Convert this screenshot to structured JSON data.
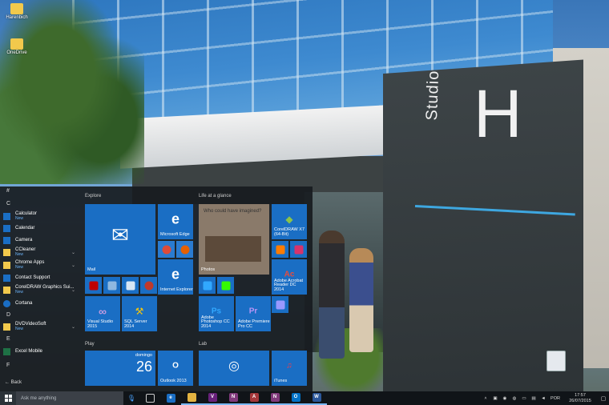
{
  "desktop": {
    "icons": [
      {
        "label": "Harenbich",
        "color": "#f2c94c"
      },
      {
        "label": "OneDrive",
        "color": "#f2c94c"
      }
    ],
    "sign": {
      "word": "Studio",
      "letter": "H",
      "accent": "#3ea7e0"
    }
  },
  "start_menu": {
    "app_list": [
      {
        "type": "letter",
        "text": "#"
      },
      {
        "type": "letter",
        "text": "C"
      },
      {
        "type": "app",
        "name": "Calculator",
        "badge": "New",
        "icon_color": "#1a6ec4"
      },
      {
        "type": "app",
        "name": "Calendar",
        "badge": "",
        "icon_color": "#1a6ec4"
      },
      {
        "type": "app",
        "name": "Camera",
        "badge": "",
        "icon_color": "#1a6ec4"
      },
      {
        "type": "app",
        "name": "CCleaner",
        "badge": "New",
        "icon_color": "#f2c94c",
        "chevron": true
      },
      {
        "type": "app",
        "name": "Chrome Apps",
        "badge": "New",
        "icon_color": "#f2c94c",
        "chevron": true
      },
      {
        "type": "app",
        "name": "Contact Support",
        "badge": "",
        "icon_color": "#1a6ec4"
      },
      {
        "type": "app",
        "name": "CorelDRAW Graphics Sui...",
        "badge": "New",
        "icon_color": "#f2c94c",
        "chevron": true
      },
      {
        "type": "app",
        "name": "Cortana",
        "badge": "",
        "icon_color": "#1a6ec4"
      },
      {
        "type": "letter",
        "text": "D"
      },
      {
        "type": "app",
        "name": "DVDVideoSoft",
        "badge": "New",
        "icon_color": "#f2c94c",
        "chevron": true
      },
      {
        "type": "letter",
        "text": "E"
      },
      {
        "type": "app",
        "name": "Excel Mobile",
        "badge": "",
        "icon_color": "#1e7145"
      },
      {
        "type": "letter",
        "text": "F"
      }
    ],
    "back_label": "Back",
    "groups": {
      "explore": "Explore",
      "life_at_a_glance": "Life at a glance",
      "play": "Play",
      "lab": "Lab"
    },
    "tiles": {
      "mail": "Mail",
      "edge": "Microsoft Edge",
      "ie": "Internet Explorer",
      "photos": "Photos",
      "photos_caption": "Who could have imagined?",
      "corel": "CorelDRAW X7 (64-Bit)",
      "acrobat": "Adobe Acrobat Reader DC 2014",
      "vs": "Visual Studio 2015",
      "sql": "SQL Server 2014",
      "photoshop": "Adobe Photoshop CC 2014",
      "premiere": "Adobe Premiere Pro CC",
      "calendar_day": "domingo",
      "calendar_date": "26",
      "outlook": "Outlook 2013",
      "groove": "Groove Music",
      "itunes": "iTunes"
    }
  },
  "taskbar": {
    "search_placeholder": "Ask me anything",
    "language": "POR",
    "time": "17:57",
    "date": "26/07/2015",
    "pinned": [
      {
        "name": "task-view",
        "glyph": "⧉",
        "color": "#101418"
      },
      {
        "name": "edge",
        "glyph": "e",
        "color": "#1a6ec4"
      },
      {
        "name": "file-explorer",
        "glyph": "▭",
        "color": "#e3b341"
      },
      {
        "name": "visual-studio",
        "glyph": "V",
        "color": "#68217a"
      },
      {
        "name": "onenote",
        "glyph": "N",
        "color": "#80397b"
      },
      {
        "name": "access",
        "glyph": "A",
        "color": "#a4373a"
      },
      {
        "name": "onenote-2",
        "glyph": "N",
        "color": "#80397b"
      },
      {
        "name": "outlook",
        "glyph": "O",
        "color": "#0072c6"
      },
      {
        "name": "word",
        "glyph": "W",
        "color": "#2b579a"
      }
    ]
  }
}
